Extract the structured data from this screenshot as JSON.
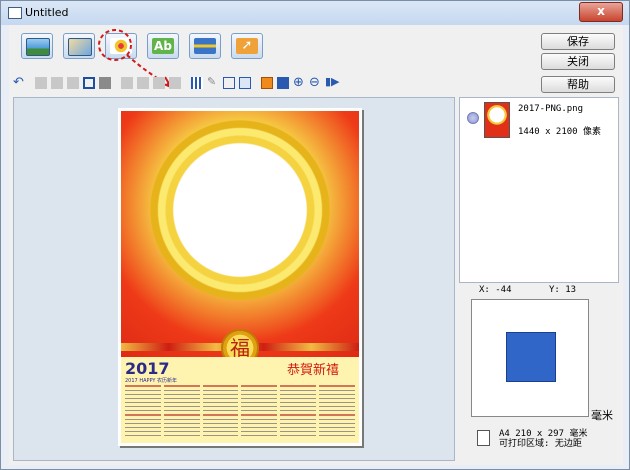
{
  "window": {
    "title": "Untitled",
    "close_glyph": "x"
  },
  "toolbar": {
    "big_buttons": [
      {
        "name": "background-tool",
        "icon": "landscape-frame-icon",
        "color": "#4a9ad8"
      },
      {
        "name": "image-tool",
        "icon": "photo-icon",
        "color": "#6fa7de"
      },
      {
        "name": "clipart-tool",
        "icon": "flower-icon",
        "color": "#f0c82c"
      },
      {
        "name": "text-tool",
        "icon": "text-abc-icon",
        "color": "#61b44a"
      },
      {
        "name": "ruler-tool",
        "icon": "ruler-icon",
        "color": "#3a74c8"
      },
      {
        "name": "select-tool",
        "icon": "pointer-icon",
        "color": "#f0a23a"
      }
    ]
  },
  "right_buttons": {
    "save": "保存",
    "close": "关闭",
    "help": "帮助"
  },
  "image_list": {
    "filename": "2017-PNG.png",
    "dimensions": "1440 x 2100 像素"
  },
  "coords": {
    "x_label": "X: -44",
    "y_label": "Y: 13"
  },
  "preview": {
    "unit": "毫米",
    "box_color": "#2f66c8"
  },
  "paper": {
    "size": "A4 210 x 297 毫米",
    "printable": "可打印区域: 无边距"
  },
  "poster": {
    "year": "2017",
    "year_sub": "2017 HAPPY 农历新年",
    "greeting": "恭賀新禧",
    "medal_char": "福"
  }
}
